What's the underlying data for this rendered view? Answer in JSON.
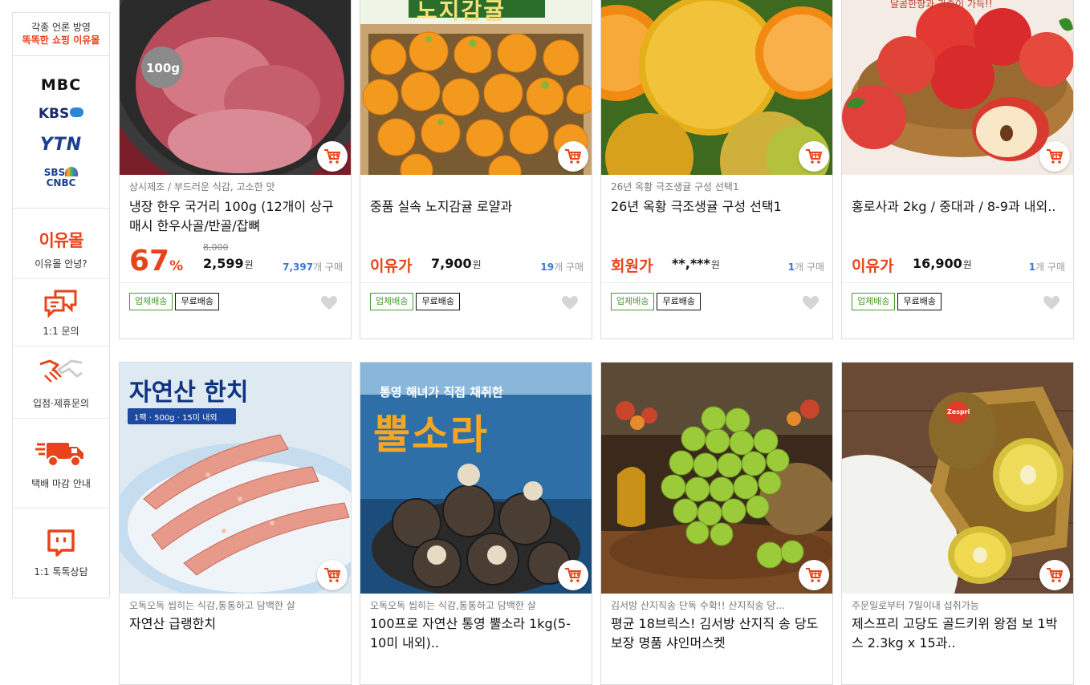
{
  "sidebar": {
    "header_line1": "각종 언론 방영",
    "header_line2": "똑똑한 쇼핑 이유몰",
    "media": [
      "MBC",
      "KBS",
      "YTN",
      "SBS",
      "CNBC"
    ],
    "brand": "이유몰",
    "items": [
      {
        "label": "이유몰 안녕?",
        "icon": "brand-logo"
      },
      {
        "label": "1:1 문의",
        "icon": "chat-bubble-icon"
      },
      {
        "label": "입점·제휴문의",
        "icon": "handshake-icon"
      },
      {
        "label": "택배 마감 안내",
        "icon": "delivery-truck-icon"
      },
      {
        "label": "1:1 톡톡상담",
        "icon": "talk-icon"
      }
    ]
  },
  "colors": {
    "accent": "#e8431a",
    "buy_count": "#3a78d8",
    "badge_green": "#4a9a2c"
  },
  "products": [
    {
      "image_text": "100g",
      "sub": "상시제조 / 부드러운 식감, 고소한 맛",
      "name": "냉장 한우 국거리 100g (12개이 상구매시 한우사골/반골/잡뼈",
      "discount": "67",
      "discount_unit": "%",
      "original_price": "8,000",
      "price": "2,599",
      "won": "원",
      "buy_count": "7,397",
      "buy_suffix": "개 구매",
      "badge1": "업체배송",
      "badge2": "무료배송"
    },
    {
      "image_text": "노지감귤",
      "sub": "",
      "name": "중품 실속 노지감귤 로얄과",
      "tag": "이유가",
      "price": "7,900",
      "won": "원",
      "buy_count": "19",
      "buy_suffix": "개 구매",
      "badge1": "업체배송",
      "badge2": "무료배송"
    },
    {
      "sub": "26년 옥황 극조생귤 구성 선택1",
      "name": "26년 옥황 극조생귤 구성 선택1",
      "tag": "회원가",
      "price": "**,***",
      "won": "원",
      "buy_count": "1",
      "buy_suffix": "개 구매",
      "badge1": "업체배송",
      "badge2": "무료배송"
    },
    {
      "image_text": "달콤한향과 과즙이 가득!!",
      "sub": "",
      "name": "홍로사과 2kg / 중대과 / 8-9과 내외..",
      "tag": "이유가",
      "price": "16,900",
      "won": "원",
      "buy_count": "1",
      "buy_suffix": "개 구매",
      "badge1": "업체배송",
      "badge2": "무료배송"
    },
    {
      "image_title": "자연산 한치",
      "image_sub": "1팩 · 500g · 15미 내외",
      "sub": "오독오독 씹히는 식감,통통하고 담백한 살",
      "name": "자연산 급랭한치"
    },
    {
      "image_title_small": "통영 해녀가 직접 채취한",
      "image_title": "뿔소라",
      "sub": "오독오독 씹히는 식감,통통하고 담백한 살",
      "name": "100프로 자연산 통영 뿔소라 1kg(5-10미 내외).."
    },
    {
      "sub": "김서방 산지직송 단독 수확!! 산지직송 당...",
      "name": "평균 18브릭스! 김서방 산지직 송 당도보장 명품 샤인머스켓"
    },
    {
      "image_text": "Zespri",
      "sub": "주문일로부터 7일이내 섭취가능",
      "name": "제스프리 고당도 골드키위 왕점 보 1박스 2.3kg x 15과.."
    }
  ]
}
